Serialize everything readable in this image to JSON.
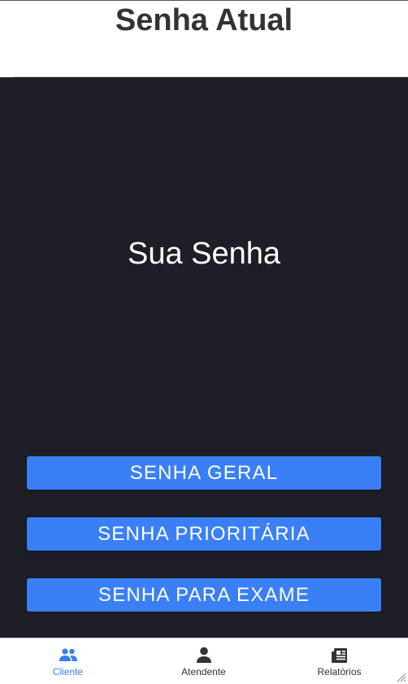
{
  "header": {
    "title": "Senha Atual"
  },
  "main": {
    "ticket_label": "Sua Senha",
    "buttons": [
      {
        "label": "SENHA GERAL"
      },
      {
        "label": "SENHA PRIORITÁRIA"
      },
      {
        "label": "SENHA PARA EXAME"
      }
    ]
  },
  "tabbar": {
    "tabs": [
      {
        "label": "Cliente",
        "icon": "people-icon",
        "active": true
      },
      {
        "label": "Atendente",
        "icon": "person-icon",
        "active": false
      },
      {
        "label": "Relatórios",
        "icon": "newspaper-icon",
        "active": false
      }
    ]
  },
  "colors": {
    "accent": "#3a7ff6",
    "background_dark": "#1e1e26",
    "header_background": "#ffffff",
    "inactive_text": "#333333"
  }
}
